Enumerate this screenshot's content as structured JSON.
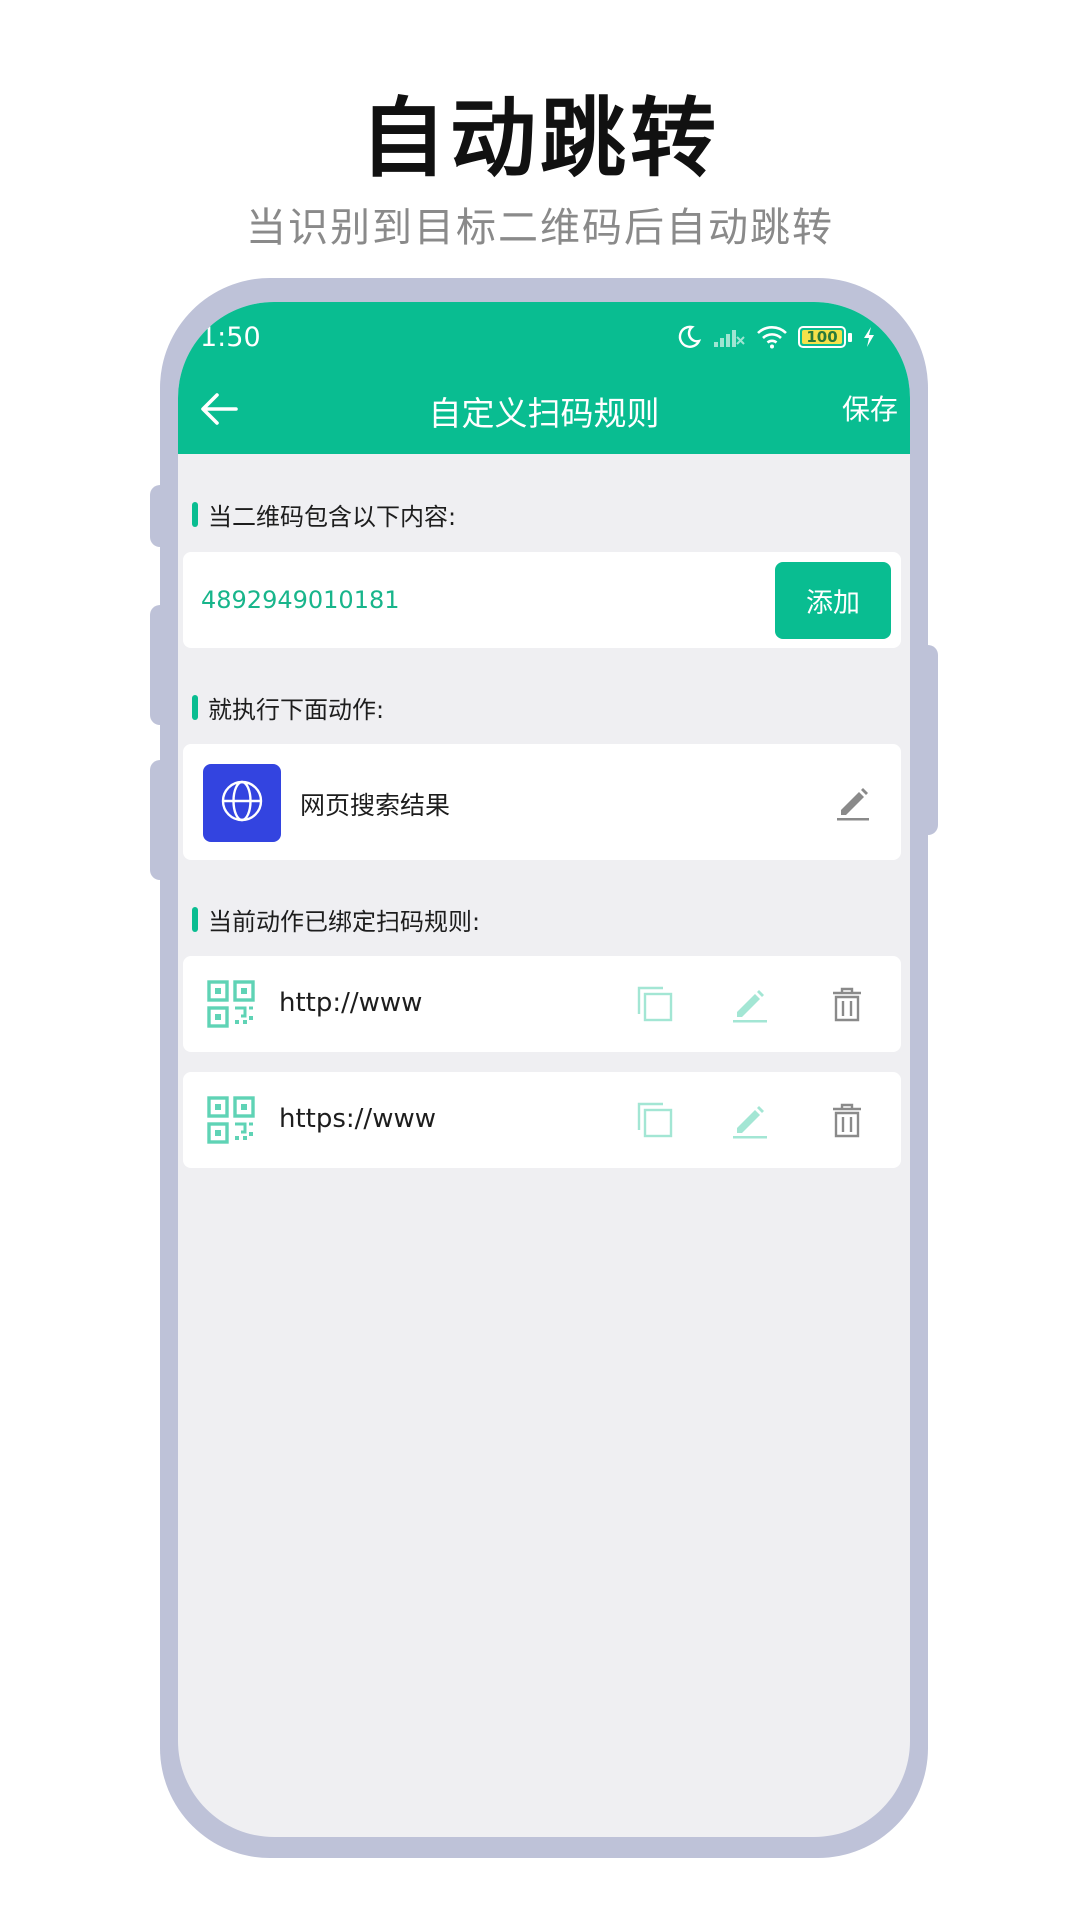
{
  "promo": {
    "title": "自动跳转",
    "subtitle": "当识别到目标二维码后自动跳转"
  },
  "status_bar": {
    "time": "1:50",
    "battery_level": "100"
  },
  "header": {
    "title": "自定义扫码规则",
    "save_label": "保存"
  },
  "condition": {
    "label": "当二维码包含以下内容:",
    "input_value": "4892949010181",
    "add_label": "添加"
  },
  "action": {
    "label": "就执行下面动作:",
    "item_label": "网页搜索结果",
    "icon": "globe-icon"
  },
  "bound_rules": {
    "label": "当前动作已绑定扫码规则:",
    "items": [
      {
        "text": "http://www"
      },
      {
        "text": "https://www"
      }
    ]
  },
  "colors": {
    "accent": "#09bd91",
    "globe_tile": "#3344e0",
    "frame": "#bec2d8",
    "screen_bg": "#efeff2"
  }
}
